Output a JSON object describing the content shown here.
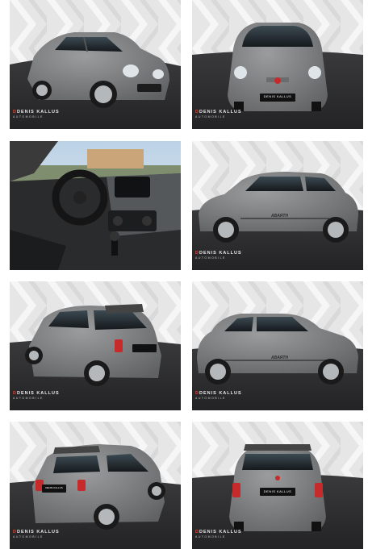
{
  "gallery": {
    "photos": [
      {
        "view": "front-three-quarter-left",
        "watermark": {
          "brand": "DENIS KALLUS",
          "sub": "AUTOMOBILE"
        }
      },
      {
        "view": "front",
        "watermark": {
          "brand": "DENIS KALLUS",
          "sub": "AUTOMOBILE"
        },
        "plate": "DENIS KALLUS"
      },
      {
        "view": "interior-dashboard",
        "watermark": null
      },
      {
        "view": "side-left",
        "watermark": {
          "brand": "DENIS KALLUS",
          "sub": "AUTOMOBILE"
        },
        "door_script": "ABARTH"
      },
      {
        "view": "rear-three-quarter-left",
        "watermark": {
          "brand": "DENIS KALLUS",
          "sub": "AUTOMOBILE"
        }
      },
      {
        "view": "side-right",
        "watermark": {
          "brand": "DENIS KALLUS",
          "sub": "AUTOMOBILE"
        },
        "door_script": "ABARTH"
      },
      {
        "view": "rear-three-quarter-right",
        "watermark": {
          "brand": "DENIS KALLUS",
          "sub": "AUTOMOBILE"
        },
        "plate": "DENIS KALLUS"
      },
      {
        "view": "rear",
        "watermark": {
          "brand": "DENIS KALLUS",
          "sub": "AUTOMOBILE"
        },
        "plate": "DENIS KALLUS"
      }
    ]
  },
  "colors": {
    "car_body": "#7a7c7e",
    "studio_floor": "#2f2f31",
    "studio_wall": "#e9e9e9",
    "brand_accent": "#e2412f",
    "tail_light": "#c62a2a"
  }
}
